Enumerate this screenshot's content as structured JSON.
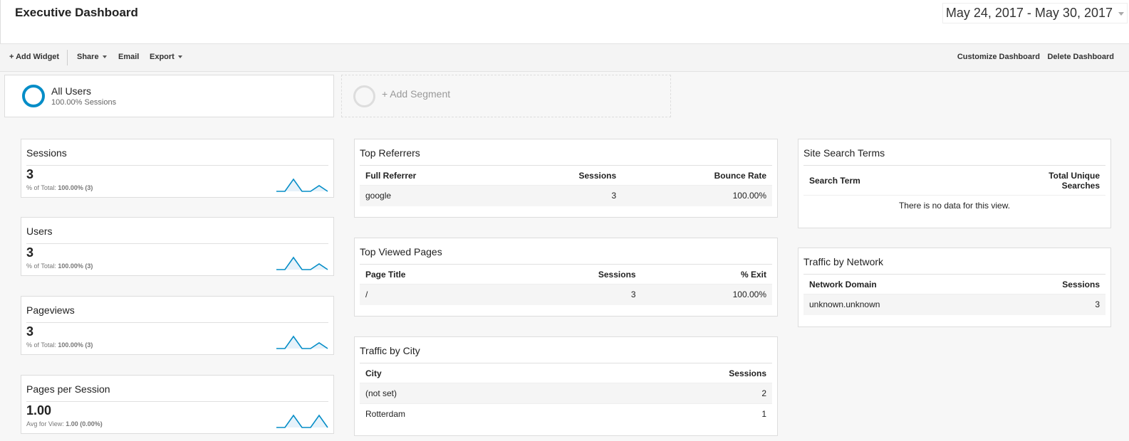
{
  "header": {
    "title": "Executive Dashboard",
    "date_range": "May 24, 2017 - May 30, 2017"
  },
  "toolbar": {
    "add_widget": "+ Add Widget",
    "share": "Share",
    "email": "Email",
    "export": "Export",
    "customize": "Customize Dashboard",
    "delete": "Delete Dashboard"
  },
  "segments": {
    "active": {
      "name": "All Users",
      "sub": "100.00% Sessions"
    },
    "add_label": "+ Add Segment"
  },
  "metrics": [
    {
      "title": "Sessions",
      "value": "3",
      "sub_label": "% of Total:",
      "sub_value": "100.00% (3)"
    },
    {
      "title": "Users",
      "value": "3",
      "sub_label": "% of Total:",
      "sub_value": "100.00% (3)"
    },
    {
      "title": "Pageviews",
      "value": "3",
      "sub_label": "% of Total:",
      "sub_value": "100.00% (3)"
    },
    {
      "title": "Pages per Session",
      "value": "1.00",
      "sub_label": "Avg for View:",
      "sub_value": "1.00 (0.00%)"
    }
  ],
  "top_referrers": {
    "title": "Top Referrers",
    "columns": [
      "Full Referrer",
      "Sessions",
      "Bounce Rate"
    ],
    "rows": [
      [
        "google",
        "3",
        "100.00%"
      ]
    ]
  },
  "top_viewed_pages": {
    "title": "Top Viewed Pages",
    "columns": [
      "Page Title",
      "Sessions",
      "% Exit"
    ],
    "rows": [
      [
        "/",
        "3",
        "100.00%"
      ]
    ]
  },
  "traffic_by_city": {
    "title": "Traffic by City",
    "columns": [
      "City",
      "Sessions"
    ],
    "rows": [
      [
        "(not set)",
        "2"
      ],
      [
        "Rotterdam",
        "1"
      ]
    ]
  },
  "site_search_terms": {
    "title": "Site Search Terms",
    "columns": [
      "Search Term",
      "Total Unique Searches"
    ],
    "empty_message": "There is no data for this view."
  },
  "traffic_by_network": {
    "title": "Traffic by Network",
    "columns": [
      "Network Domain",
      "Sessions"
    ],
    "rows": [
      [
        "unknown.unknown",
        "3"
      ]
    ]
  },
  "colors": {
    "accent": "#058dc7",
    "sparkline_fill": "#e6f2fa"
  }
}
